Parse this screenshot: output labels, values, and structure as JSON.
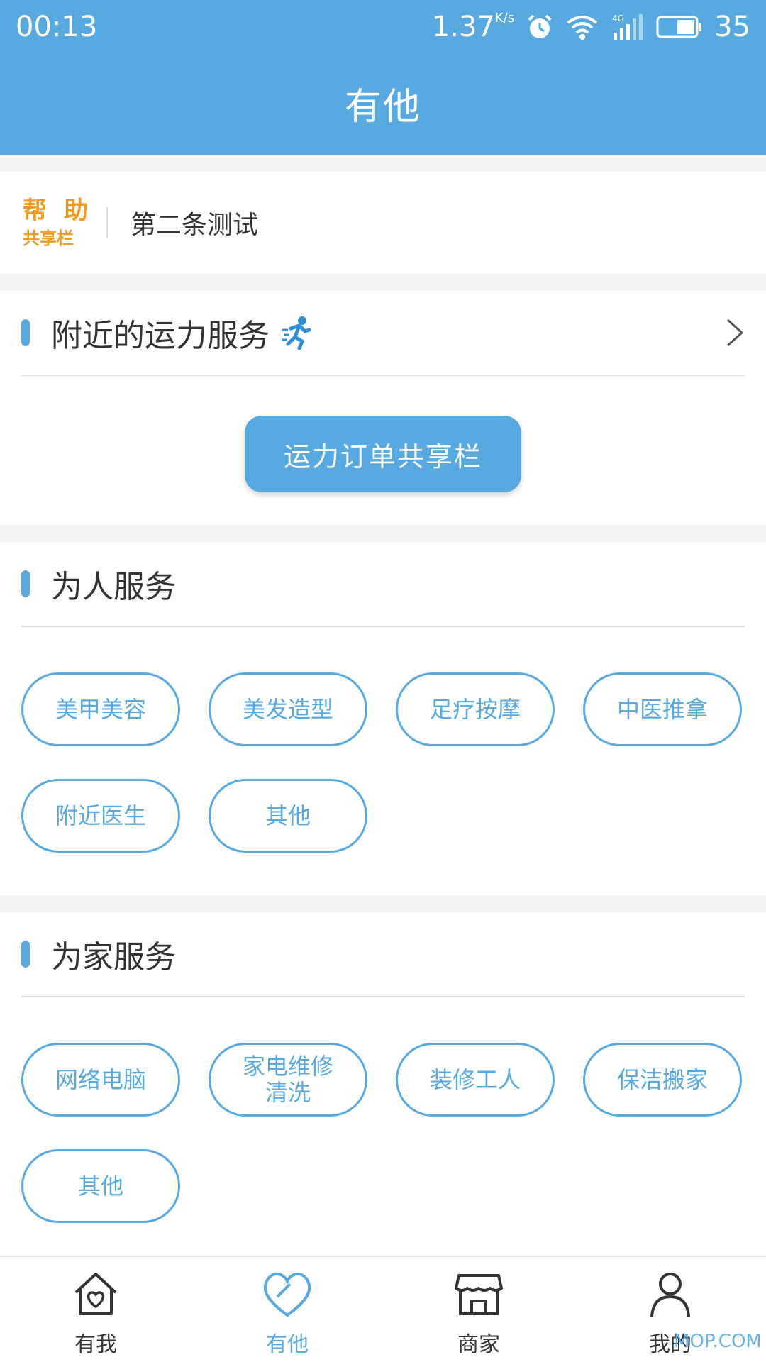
{
  "status_bar": {
    "time": "00:13",
    "speed": "1.37",
    "speed_unit": "K/s",
    "battery": "35",
    "icons": [
      "alarm-icon",
      "wifi-icon",
      "signal-4g-icon",
      "battery-icon"
    ]
  },
  "header": {
    "title": "有他"
  },
  "notice": {
    "badge_top": "帮 助",
    "badge_bottom": "共享栏",
    "message": "第二条测试"
  },
  "nearby": {
    "title": "附近的运力服务",
    "button": "运力订单共享栏"
  },
  "for_people": {
    "title": "为人服务",
    "tags": [
      "美甲美容",
      "美发造型",
      "足疗按摩",
      "中医推拿",
      "附近医生",
      "其他"
    ]
  },
  "for_home": {
    "title": "为家服务",
    "tags": [
      "网络电脑",
      "家电维修\n清洗",
      "装修工人",
      "保洁搬家",
      "其他"
    ]
  },
  "bottom_nav": {
    "items": [
      {
        "label": "有我",
        "icon": "home-heart-icon"
      },
      {
        "label": "有他",
        "icon": "heart-icon",
        "active": true
      },
      {
        "label": "商家",
        "icon": "shop-icon"
      },
      {
        "label": "我的",
        "icon": "user-icon"
      }
    ]
  },
  "watermark": "MOP.COM",
  "colors": {
    "primary": "#58a9df",
    "accent": "#f09a21"
  }
}
